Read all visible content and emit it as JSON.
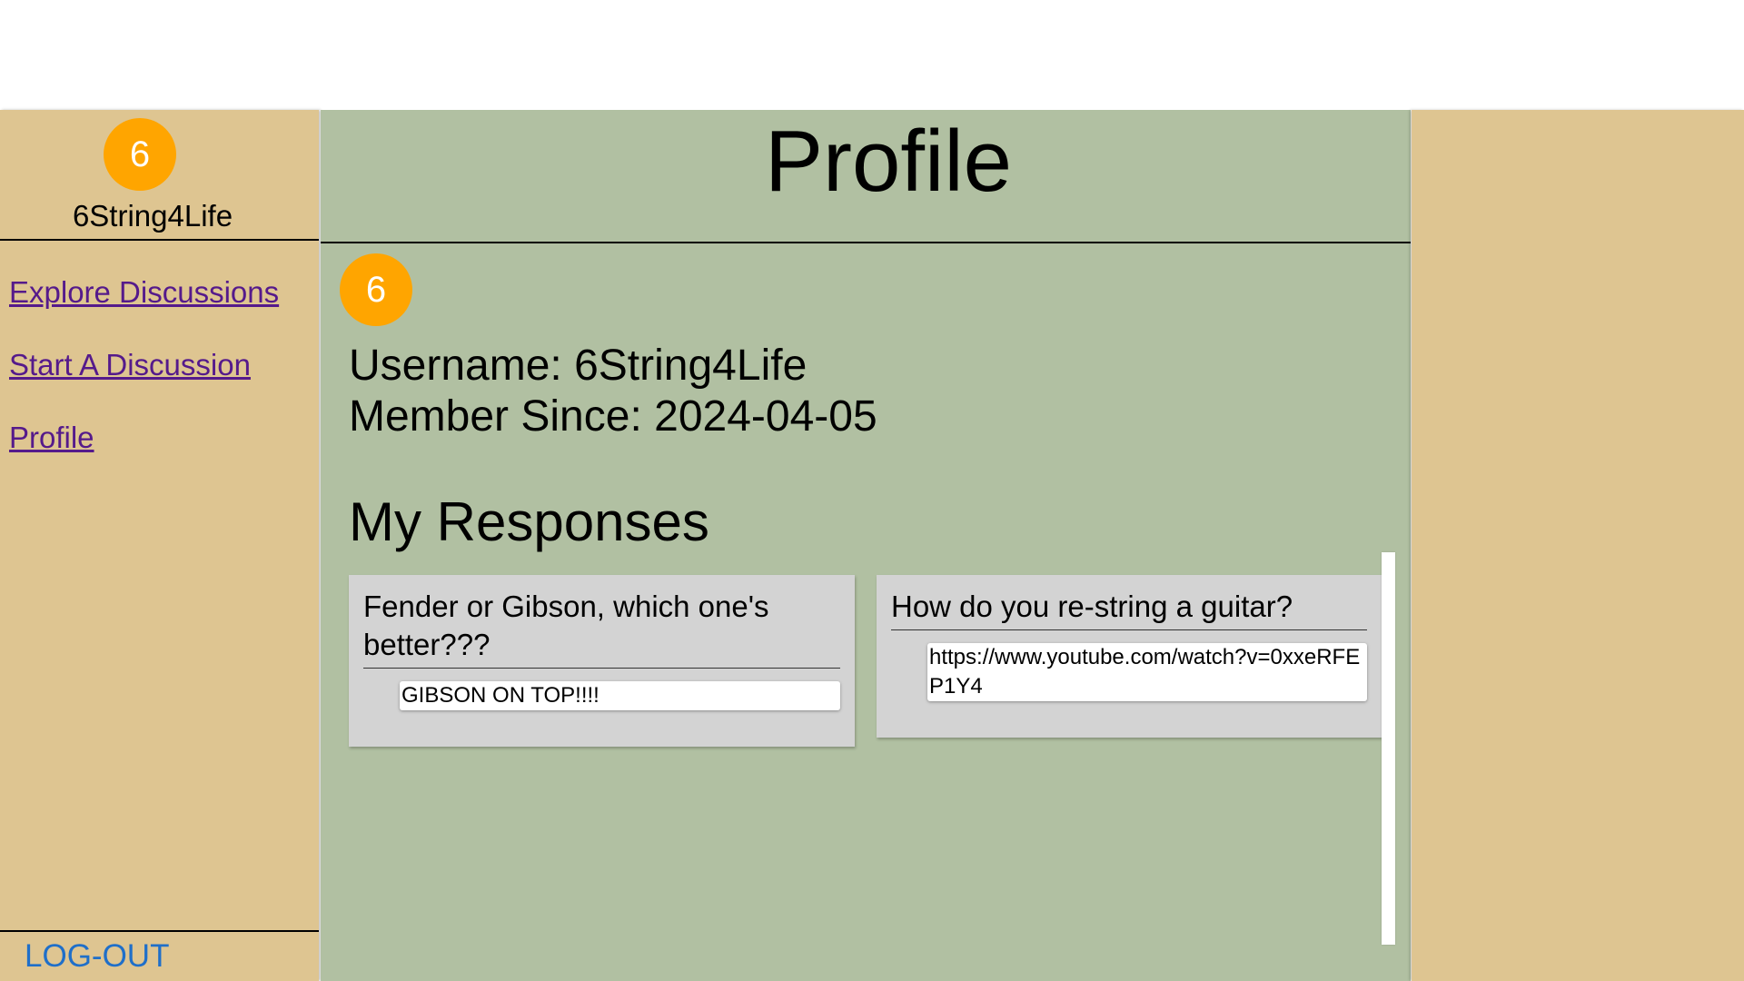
{
  "sidebar": {
    "avatar_letter": "6",
    "username": "6String4Life",
    "nav": [
      {
        "label": "Explore Discussions"
      },
      {
        "label": "Start A Discussion"
      },
      {
        "label": "Profile"
      }
    ],
    "logout_label": "LOG-OUT"
  },
  "main": {
    "title": "Profile",
    "avatar_letter": "6",
    "username_line": "Username: 6String4Life",
    "member_since_line": "Member Since: 2024-04-05",
    "responses_heading": "My Responses",
    "responses": [
      {
        "discussion": "Fender or Gibson, which one's better???",
        "response": "GIBSON ON TOP!!!!"
      },
      {
        "discussion": "How do you re-string a guitar?",
        "response": "https://www.youtube.com/watch?v=0xxeRFEP1Y4"
      }
    ]
  },
  "colors": {
    "sidebar_bg": "#dec591",
    "main_bg": "#b1c0a2",
    "avatar": "#ffa500",
    "link_visited": "#551a8b",
    "logout": "#1f6fc9",
    "card_bg": "#d3d3d3"
  }
}
